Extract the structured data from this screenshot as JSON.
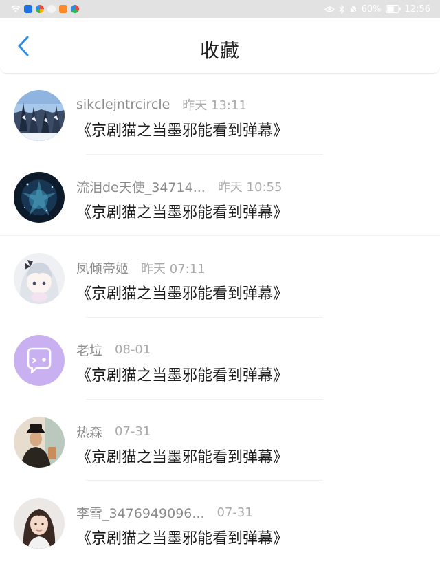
{
  "status_bar": {
    "battery": "60%",
    "time": "12:56"
  },
  "header": {
    "title": "收藏"
  },
  "items": [
    {
      "name": "sikclejntrcircle",
      "time": "昨天 13:11",
      "content": "《京剧猫之当墨邪能看到弹幕》",
      "avatar": "winter-forest-avatar"
    },
    {
      "name": "流泪de天使_34714...",
      "time": "昨天 10:55",
      "content": "《京剧猫之当墨邪能看到弹幕》",
      "avatar": "dark-galaxy-avatar"
    },
    {
      "name": "凤倾帝姬",
      "time": "昨天 07:11",
      "content": "《京剧猫之当墨邪能看到弹幕》",
      "avatar": "anime-girl-avatar"
    },
    {
      "name": "老垃",
      "time": "08-01",
      "content": "《京剧猫之当墨邪能看到弹幕》",
      "avatar": "default-chat-avatar"
    },
    {
      "name": "热森",
      "time": "07-31",
      "content": "《京剧猫之当墨邪能看到弹幕》",
      "avatar": "person-hat-avatar"
    },
    {
      "name": "李雪_3476949096...",
      "time": "07-31",
      "content": "《京剧猫之当墨邪能看到弹幕》",
      "avatar": "portrait-girl-avatar"
    }
  ],
  "colors": {
    "accent": "#2a8ee8",
    "name_gray": "#8c8c8c",
    "time_gray": "#aaaaaa",
    "default_avatar_purple": "#c9b0f0"
  }
}
